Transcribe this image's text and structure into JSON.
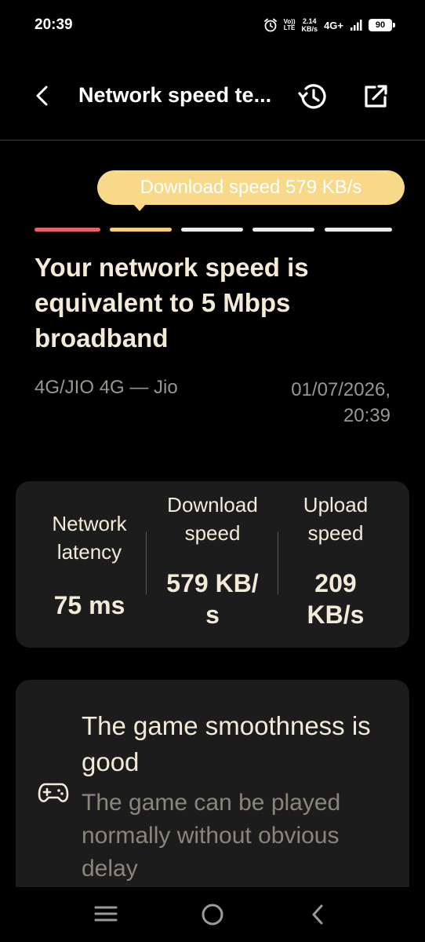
{
  "status_bar": {
    "time": "20:39",
    "volte_top": "Vo))",
    "volte_bottom": "LTE",
    "speed_value": "2.14",
    "speed_unit": "KB/s",
    "network_type": "4G+",
    "battery": "90"
  },
  "app_bar": {
    "title": "Network speed te...",
    "icons": [
      "back-arrow",
      "history",
      "open-external"
    ]
  },
  "tooltip": {
    "text": "Download speed 579 KB/s"
  },
  "segments": [
    {
      "color": "#e8616a"
    },
    {
      "color": "#f3cf7c"
    },
    {
      "color": "#ebebeb"
    },
    {
      "color": "#ebebeb"
    },
    {
      "color": "#ebebeb"
    }
  ],
  "result": {
    "headline": "Your network speed is equivalent to 5 Mbps broadband",
    "network": "4G/JIO 4G — Jio",
    "date": "01/07/2026,",
    "time": "20:39"
  },
  "stats": {
    "latency_label_1": "Network",
    "latency_label_2": "latency",
    "latency_value": "75 ms",
    "download_label_1": "Download",
    "download_label_2": "speed",
    "download_value_1": "579 KB/",
    "download_value_2": "s",
    "upload_label_1": "Upload",
    "upload_label_2": "speed",
    "upload_value_1": "209",
    "upload_value_2": "KB/s"
  },
  "game": {
    "icon": "gamepad",
    "title": "The game smoothness is good",
    "description": "The game can be played normally without obvious delay"
  },
  "nav": {
    "icons": [
      "recents",
      "home",
      "back"
    ]
  },
  "colors": {
    "background": "#000000",
    "card": "#1c1c1c",
    "accent_yellow": "#f8d98a",
    "text_primary": "#f3ead8",
    "text_secondary": "#9a9690"
  }
}
